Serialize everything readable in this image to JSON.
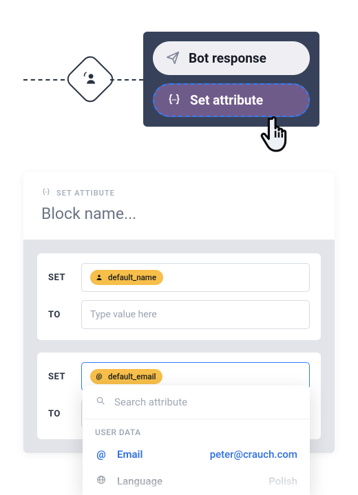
{
  "menu": {
    "bot_response": "Bot response",
    "set_attribute": "Set attribute"
  },
  "editor": {
    "eyebrow": "SET ATTIBUTE",
    "block_name": "Block name..."
  },
  "rows": [
    {
      "set_label": "SET",
      "to_label": "TO",
      "chip_icon": "user",
      "chip_text": "default_name",
      "to_placeholder": "Type value here",
      "focused": false
    },
    {
      "set_label": "SET",
      "to_label": "TO",
      "chip_icon": "at",
      "chip_text": "default_email",
      "to_placeholder": "",
      "focused": true
    }
  ],
  "dropdown": {
    "search_placeholder": "Search attribute",
    "section": "USER DATA",
    "items": [
      {
        "icon": "@",
        "name": "Email",
        "value": "peter@crauch.com",
        "active": true
      },
      {
        "icon": "globe",
        "name": "Language",
        "value": "Polish",
        "active": false
      }
    ]
  }
}
